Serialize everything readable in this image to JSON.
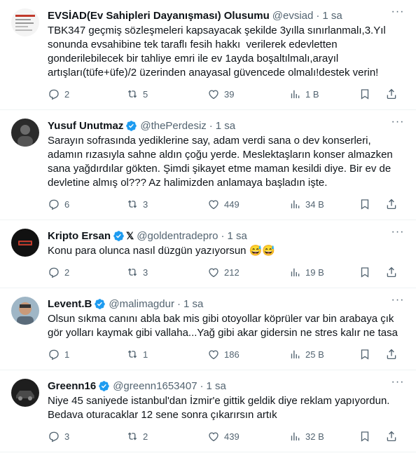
{
  "tweets": [
    {
      "name": "EVSİAD(Ev Sahipleri Dayanışması) Olusumu",
      "handle": "@evsiad",
      "time": "1 sa",
      "verified": false,
      "text": "TBK347 geçmiş sözleşmeleri kapsayacak şekilde 3yılla sınırlanmalı,3.Yıl sonunda evsahibine tek taraflı fesih hakkı  verilerek edevletten gonderilebilecek bir tahliye emri ile ev 1ayda boşaltılmalı,arayıl artışları(tüfe+üfe)/2 üzerinden anayasal güvencede olmalı!destek verin!",
      "replies": "2",
      "retweets": "5",
      "likes": "39",
      "views": "1 B",
      "avatar_style": "document"
    },
    {
      "name": "Yusuf Unutmaz",
      "handle": "@thePerdesiz",
      "time": "1 sa",
      "verified": true,
      "text": "Sarayın sofrasında yediklerine say, adam verdi sana o dev konserleri, adamın rızasıyla sahne aldın çoğu yerde. Meslektaşların konser almazken sana yağdırdılar gökten. Şimdi şikayet etme maman kesildi diye. Bir ev de devletine almış ol??? Az halimizden anlamaya başladın işte.",
      "replies": "6",
      "retweets": "3",
      "likes": "449",
      "views": "34 B",
      "avatar_style": "dark"
    },
    {
      "name": "Kripto Ersan",
      "handle": "@goldentradepro",
      "time": "1 sa",
      "verified": true,
      "x_badge": "𝕏",
      "text": "Konu para olunca nasıl düzgün yazıyorsun 😅😅",
      "replies": "2",
      "retweets": "3",
      "likes": "212",
      "views": "19 B",
      "avatar_style": "logo"
    },
    {
      "name": "Levent.B",
      "handle": "@malimagdur",
      "time": "1 sa",
      "verified": true,
      "text": "Olsun sıkma canını abla bak mis gibi otoyollar köprüler var bin arabaya çık gör yolları kaymak gibi vallaha...Yağ gibi akar gidersin ne stres kalır ne tasa",
      "replies": "1",
      "retweets": "1",
      "likes": "186",
      "views": "25 B",
      "avatar_style": "photo"
    },
    {
      "name": "Greenn16",
      "handle": "@greenn1653407",
      "time": "1 sa",
      "verified": true,
      "text": "Niye 45 saniyede istanbul'dan İzmir'e gittik geldik diye reklam yapıyordun. Bedava oturacaklar 12 sene sonra çıkarırsın artık",
      "replies": "3",
      "retweets": "2",
      "likes": "439",
      "views": "32 B",
      "avatar_style": "car"
    }
  ],
  "more_icon": "···",
  "colors": {
    "verified": "#1d9bf0",
    "muted": "#536471",
    "text": "#0f1419",
    "divider": "#eff3f4"
  }
}
